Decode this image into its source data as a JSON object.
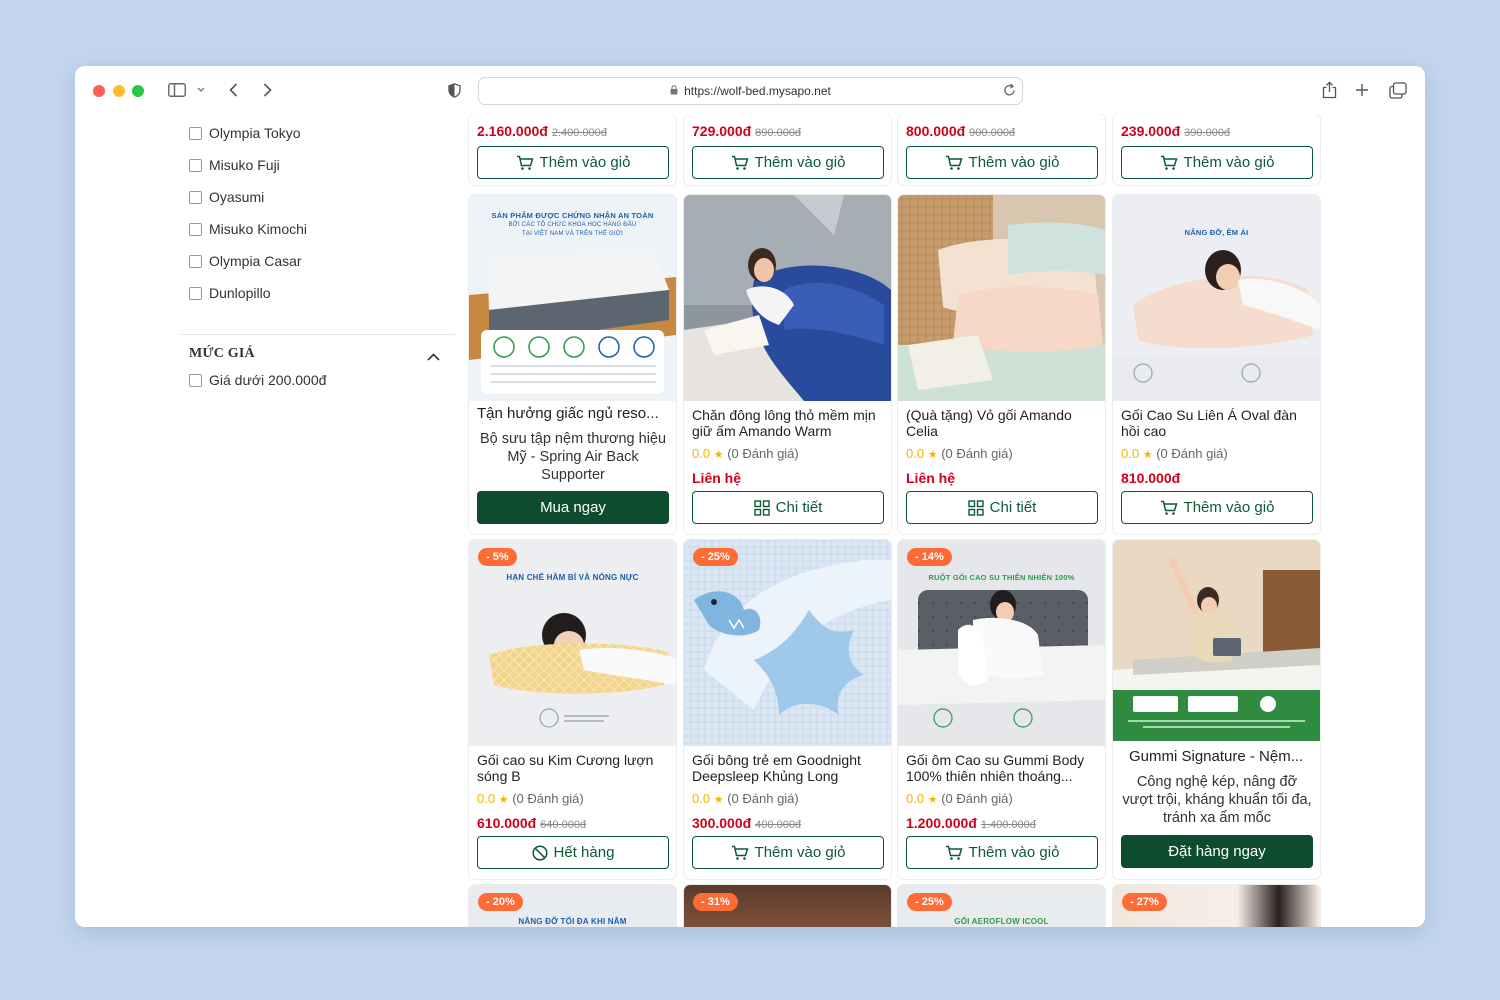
{
  "browser": {
    "url": "https://wolf-bed.mysapo.net"
  },
  "sidebar": {
    "brands": [
      "Olympia Tokyo",
      "Misuko Fuji",
      "Oyasumi",
      "Misuko Kimochi",
      "Olympia Casar",
      "Dunlopillo"
    ],
    "price_section_title": "MỨC GIÁ",
    "price_options": [
      "Giá dưới 200.000đ"
    ]
  },
  "top_row": [
    {
      "price": "2.160.000đ",
      "old_price": "2.400.000đ",
      "button": "Thêm vào giỏ"
    },
    {
      "price": "729.000đ",
      "old_price": "890.000đ",
      "button": "Thêm vào giỏ"
    },
    {
      "price": "800.000đ",
      "old_price": "900.000đ",
      "button": "Thêm vào giỏ"
    },
    {
      "price": "239.000đ",
      "old_price": "390.000đ",
      "button": "Thêm vào giỏ"
    }
  ],
  "row2": [
    {
      "title": "Tận hưởng giấc ngủ reso...",
      "desc": "Bộ sưu tập nệm thương hiệu Mỹ - Spring Air Back Supporter",
      "button": "Mua ngay",
      "image_caption_1": "SẢN PHẨM ĐƯỢC CHỨNG NHẬN AN TOÀN",
      "image_caption_2": "BỞI CÁC TỔ CHỨC KHOA HỌC HÀNG ĐẦU",
      "image_caption_3": "TẠI VIỆT NAM VÀ TRÊN THẾ GIỚI"
    },
    {
      "name": "Chăn đông lông thỏ mềm mịn giữ ấm Amando Warm",
      "score": "0.0",
      "reviews": "(0 Đánh giá)",
      "price": "Liên hệ",
      "button": "Chi tiết"
    },
    {
      "name": "(Quà tặng) Vỏ gối Amando Celia",
      "score": "0.0",
      "reviews": "(0 Đánh giá)",
      "price": "Liên hệ",
      "button": "Chi tiết"
    },
    {
      "name": "Gối Cao Su Liên Á Oval đàn hồi cao",
      "score": "0.0",
      "reviews": "(0 Đánh giá)",
      "price": "810.000đ",
      "button": "Thêm vào giỏ",
      "image_caption": "NÂNG ĐỠ, ÊM ÁI"
    }
  ],
  "row3": [
    {
      "badge": "- 5%",
      "name": "Gối cao su Kim Cương lượn sóng B",
      "score": "0.0",
      "reviews": "(0 Đánh giá)",
      "price": "610.000đ",
      "old_price": "640.000đ",
      "button": "Hết hàng",
      "image_caption": "HẠN CHẾ HẦM BÍ VÀ NÓNG NỰC"
    },
    {
      "badge": "- 25%",
      "name": "Gối bông trẻ em Goodnight Deepsleep Khủng Long",
      "score": "0.0",
      "reviews": "(0 Đánh giá)",
      "price": "300.000đ",
      "old_price": "400.000đ",
      "button": "Thêm vào giỏ"
    },
    {
      "badge": "- 14%",
      "name": "Gối ôm Cao su Gummi Body 100% thiên nhiên thoáng...",
      "score": "0.0",
      "reviews": "(0 Đánh giá)",
      "price": "1.200.000đ",
      "old_price": "1.400.000đ",
      "button": "Thêm vào giỏ",
      "image_caption": "RUỘT GỐI CAO SU THIÊN NHIÊN 100%"
    },
    {
      "title": "Gummi Signature - Nệm...",
      "desc": "Công nghệ kép, nâng đỡ vượt trội, kháng khuẩn tối đa, tránh xa ẩm mốc",
      "button": "Đặt hàng ngay"
    }
  ],
  "row4": [
    {
      "badge": "- 20%",
      "image_caption": "NÂNG ĐỠ TỐI ĐA KHI NẰM"
    },
    {
      "badge": "- 31%"
    },
    {
      "badge": "- 25%",
      "image_caption": "GỐI AEROFLOW ICOOL"
    },
    {
      "badge": "- 27%"
    }
  ],
  "colors": {
    "brand_green": "#0d4d2e",
    "price_red": "#d0021b",
    "badge_orange": "#ff6b35",
    "star_yellow": "#f5b400",
    "desktop_bg": "#c3d6ee"
  }
}
